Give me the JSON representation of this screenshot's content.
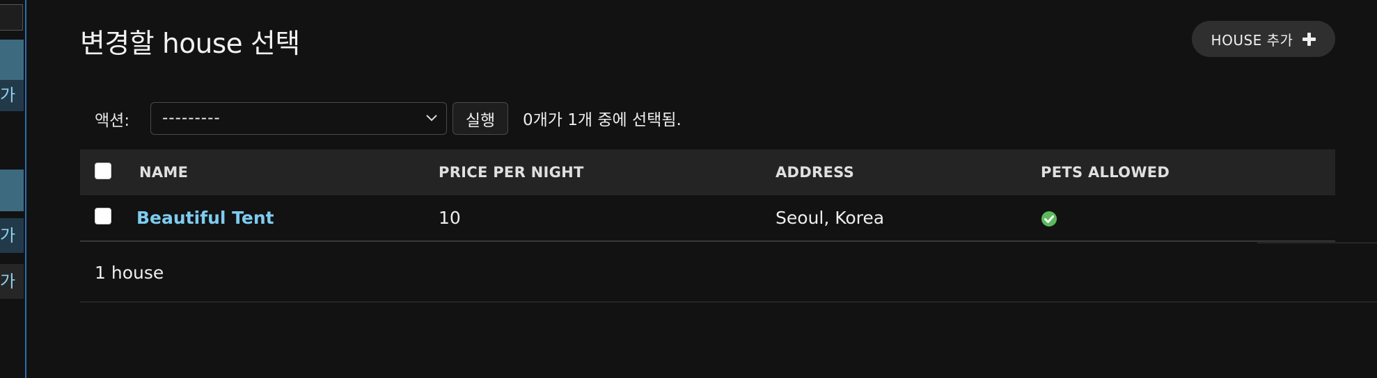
{
  "sidebar": {
    "item_fragments": [
      "가",
      "가",
      "가"
    ]
  },
  "header": {
    "title": "변경할 house 선택",
    "add_button_label": "HOUSE 추가"
  },
  "actions": {
    "label": "액션:",
    "selected_value": "---------",
    "go_button_label": "실행",
    "selection_counter": "0개가 1개 중에 선택됨."
  },
  "table": {
    "columns": [
      "NAME",
      "PRICE PER NIGHT",
      "ADDRESS",
      "PETS ALLOWED"
    ],
    "rows": [
      {
        "name": "Beautiful Tent",
        "price_per_night": "10",
        "address": "Seoul, Korea",
        "pets_allowed": "yes-icon"
      }
    ]
  },
  "paginator": "1 house",
  "colors": {
    "background": "#121212",
    "link": "#7ecbf0",
    "header_row": "#242424",
    "check_green": "#5cb85c",
    "sidebar_accent": "#2b6fb3"
  }
}
